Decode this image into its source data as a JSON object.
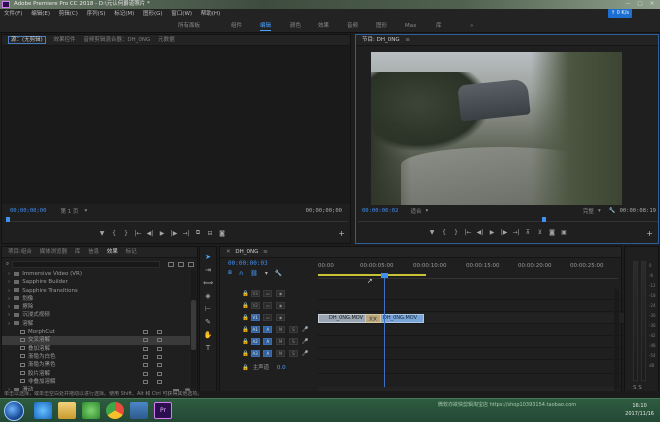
{
  "window": {
    "title": "Adobe Premiere Pro CC 2018 - D:\\元认何爵道照片 *",
    "controls": [
      "—",
      "□",
      "✕"
    ]
  },
  "menu": [
    "文件(F)",
    "编辑(E)",
    "剪辑(C)",
    "序列(S)",
    "标记(M)",
    "图形(G)",
    "窗口(W)",
    "帮助(H)"
  ],
  "workspaces": [
    "所有面板",
    "组件",
    "编辑",
    "颜色",
    "效果",
    "音频",
    "图形",
    "Max",
    "库"
  ],
  "net_badge": "↑ 0 K/s",
  "source_panel": {
    "tabs": [
      "源：(无剪辑)",
      "效果控件",
      "音频剪辑混合器：DH_0NG",
      "元数据"
    ],
    "timecode_left": "00;00;00;00",
    "fit_label": "第 1 页",
    "timecode_right": "00;00;00;00"
  },
  "program_panel": {
    "tab": "节目: DH_0NG",
    "timecode_left": "00:00:06:02",
    "fit_label": "适合",
    "quality": "完整",
    "timecode_right": "00:00:08:19"
  },
  "project_panel": {
    "tabs": [
      "项目:组合",
      "媒体浏览器",
      "库",
      "信息",
      "效果",
      "标记"
    ],
    "items": [
      {
        "label": "Immersive Video (VR)",
        "kind": "fold"
      },
      {
        "label": "Sapphire Builder",
        "kind": "fold"
      },
      {
        "label": "Sapphire Transitions",
        "kind": "fold"
      },
      {
        "label": "划像",
        "kind": "fold"
      },
      {
        "label": "擦除",
        "kind": "fold"
      },
      {
        "label": "沉浸式视频",
        "kind": "fold"
      },
      {
        "label": "溶解",
        "kind": "fold"
      },
      {
        "label": "MorphCut",
        "kind": "fx"
      },
      {
        "label": "交叉溶解",
        "kind": "fx",
        "selected": true
      },
      {
        "label": "叠加溶解",
        "kind": "fx"
      },
      {
        "label": "渐隐为白色",
        "kind": "fx"
      },
      {
        "label": "渐隐为黑色",
        "kind": "fx"
      },
      {
        "label": "胶片溶解",
        "kind": "fx"
      },
      {
        "label": "非叠加溶解",
        "kind": "fx"
      },
      {
        "label": "滑动",
        "kind": "fold"
      },
      {
        "label": "缩放",
        "kind": "fold"
      }
    ]
  },
  "timeline": {
    "tab": "DH_0NG",
    "timecode": "00:00:00:03",
    "ruler": [
      "00:00",
      "00:00:05:00",
      "00:00:10:00",
      "00:00:15:00",
      "00:00:20:00",
      "00:00:25:00"
    ],
    "video_tracks": [
      "V3",
      "V2",
      "V1"
    ],
    "audio_tracks": [
      "A1",
      "A2",
      "A3"
    ],
    "master_label": "主声道",
    "master_value": "0.0",
    "clip_a": "DH_0NG.MOV",
    "clip_b": "DH_0NG.MOV",
    "transition": "交叉"
  },
  "status_bar": "单击以选择，或单击空白处并拖动以进行选择。使用 Shift、Alt 和 Ctrl 可获得其他选项。",
  "taskbar": {
    "watermark": "微软亦欲快剪辑淘宝店 https://shop103931​54.taobao.com",
    "time": "16:10",
    "date": "2017/11/16",
    "apps": [
      "ie-icon",
      "folder-icon",
      "video-icon",
      "chrome-icon",
      "photo-icon",
      "premiere-icon"
    ]
  },
  "colors": {
    "accent": "#3f8ff5",
    "taskbar": "#2b5a3e",
    "premiere": "#2b0f4e"
  }
}
